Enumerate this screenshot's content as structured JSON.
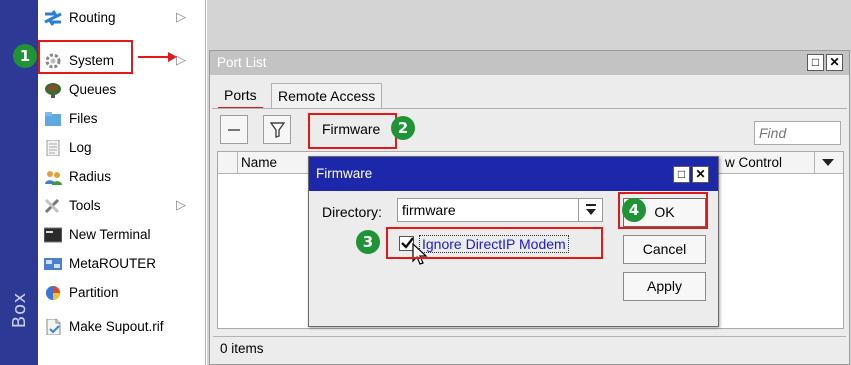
{
  "brand": {
    "strip_text": "Box"
  },
  "sidebar": {
    "items": [
      {
        "label": "Routing",
        "icon": "routing-icon",
        "has_submenu": true
      },
      {
        "label": "System",
        "icon": "system-gear-icon",
        "has_submenu": true
      },
      {
        "label": "Queues",
        "icon": "queues-icon",
        "has_submenu": false
      },
      {
        "label": "Files",
        "icon": "folder-icon",
        "has_submenu": false
      },
      {
        "label": "Log",
        "icon": "log-icon",
        "has_submenu": false
      },
      {
        "label": "Radius",
        "icon": "radius-users-icon",
        "has_submenu": false
      },
      {
        "label": "Tools",
        "icon": "tools-icon",
        "has_submenu": true
      },
      {
        "label": "New Terminal",
        "icon": "terminal-icon",
        "has_submenu": false
      },
      {
        "label": "MetaROUTER",
        "icon": "metarouter-icon",
        "has_submenu": false
      },
      {
        "label": "Partition",
        "icon": "partition-pie-icon",
        "has_submenu": false
      },
      {
        "label": "Make Supout.rif",
        "icon": "document-icon",
        "has_submenu": false
      }
    ]
  },
  "port_list": {
    "title": "Port List",
    "tabs": [
      "Ports",
      "Remote Access"
    ],
    "active_tab": "Ports",
    "toolbar": {
      "firmware_label": "Firmware",
      "find_placeholder": "Find"
    },
    "columns": [
      "Name",
      "w Control"
    ],
    "status": "0 items"
  },
  "firmware_dialog": {
    "title": "Firmware",
    "directory_label": "Directory:",
    "directory_value": "firmware",
    "checkbox_label": "Ignore DirectIP Modem",
    "checkbox_checked": true,
    "buttons": {
      "ok": "OK",
      "cancel": "Cancel",
      "apply": "Apply"
    }
  },
  "annotations": {
    "steps": [
      "1",
      "2",
      "3",
      "4"
    ]
  },
  "colors": {
    "dialog_title": "#1d27a9",
    "highlight": "#e01919",
    "badge": "#1f9437",
    "strip": "#2d3a95"
  }
}
